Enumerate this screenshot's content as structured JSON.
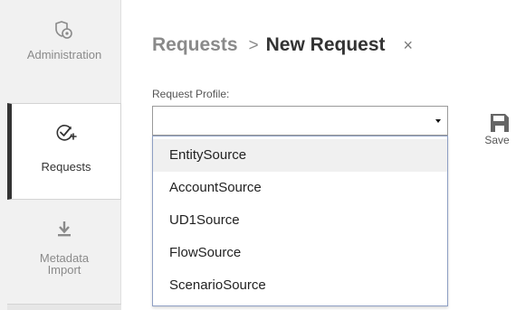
{
  "sidebar": {
    "items": [
      {
        "label": "Administration",
        "icon": "shield-settings-icon",
        "active": false
      },
      {
        "label": "Requests",
        "icon": "check-plus-icon",
        "active": true
      },
      {
        "label": "Metadata\nImport",
        "icon": "download-icon",
        "active": false
      }
    ]
  },
  "breadcrumb": {
    "root": "Requests",
    "separator": ">",
    "current": "New Request",
    "close": "×"
  },
  "form": {
    "profile_label": "Request Profile:",
    "profile_value": "",
    "options": [
      "EntitySource",
      "AccountSource",
      "UD1Source",
      "FlowSource",
      "ScenarioSource"
    ],
    "highlighted_option": "EntitySource"
  },
  "toolbar": {
    "save_label": "Save",
    "save_icon": "floppy-disk-icon"
  },
  "colors": {
    "sidebar_bg": "#f1f1f1",
    "active_indicator": "#333333",
    "dropdown_border": "#8e9fc3",
    "highlight": "#f0f0f0"
  }
}
